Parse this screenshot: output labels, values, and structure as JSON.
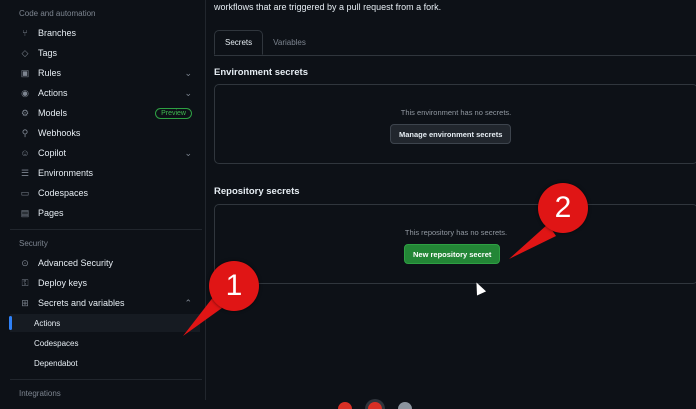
{
  "sidebar": {
    "section_code": "Code and automation",
    "items": [
      {
        "label": "Branches",
        "icon": "branch-icon"
      },
      {
        "label": "Tags",
        "icon": "tag-icon"
      },
      {
        "label": "Rules",
        "icon": "rules-icon"
      },
      {
        "label": "Actions",
        "icon": "play-icon"
      },
      {
        "label": "Models",
        "icon": "models-icon",
        "badge": "Preview"
      },
      {
        "label": "Webhooks",
        "icon": "webhook-icon"
      },
      {
        "label": "Copilot",
        "icon": "copilot-icon"
      },
      {
        "label": "Environments",
        "icon": "server-icon"
      },
      {
        "label": "Codespaces",
        "icon": "codespaces-icon"
      },
      {
        "label": "Pages",
        "icon": "browser-icon"
      }
    ],
    "section_security": "Security",
    "security_items": [
      {
        "label": "Advanced Security",
        "icon": "codescan-icon"
      },
      {
        "label": "Deploy keys",
        "icon": "key-icon"
      },
      {
        "label": "Secrets and variables",
        "icon": "asterisk-icon"
      }
    ],
    "sub_items": [
      {
        "label": "Actions",
        "active": true
      },
      {
        "label": "Codespaces"
      },
      {
        "label": "Dependabot"
      }
    ],
    "section_integrations": "Integrations"
  },
  "main": {
    "intro": "workflows that are triggered by a pull request from a fork.",
    "tabs": [
      "Secrets",
      "Variables"
    ],
    "env_title": "Environment secrets",
    "env_empty": "This environment has no secrets.",
    "env_button": "Manage environment secrets",
    "repo_title": "Repository secrets",
    "repo_empty": "This repository has no secrets.",
    "repo_button": "New repository secret"
  },
  "annotations": {
    "one": "1",
    "two": "2"
  },
  "colors": {
    "accent_green": "#238636",
    "annotation_red": "#e01515",
    "active_blue": "#2f81f7"
  }
}
